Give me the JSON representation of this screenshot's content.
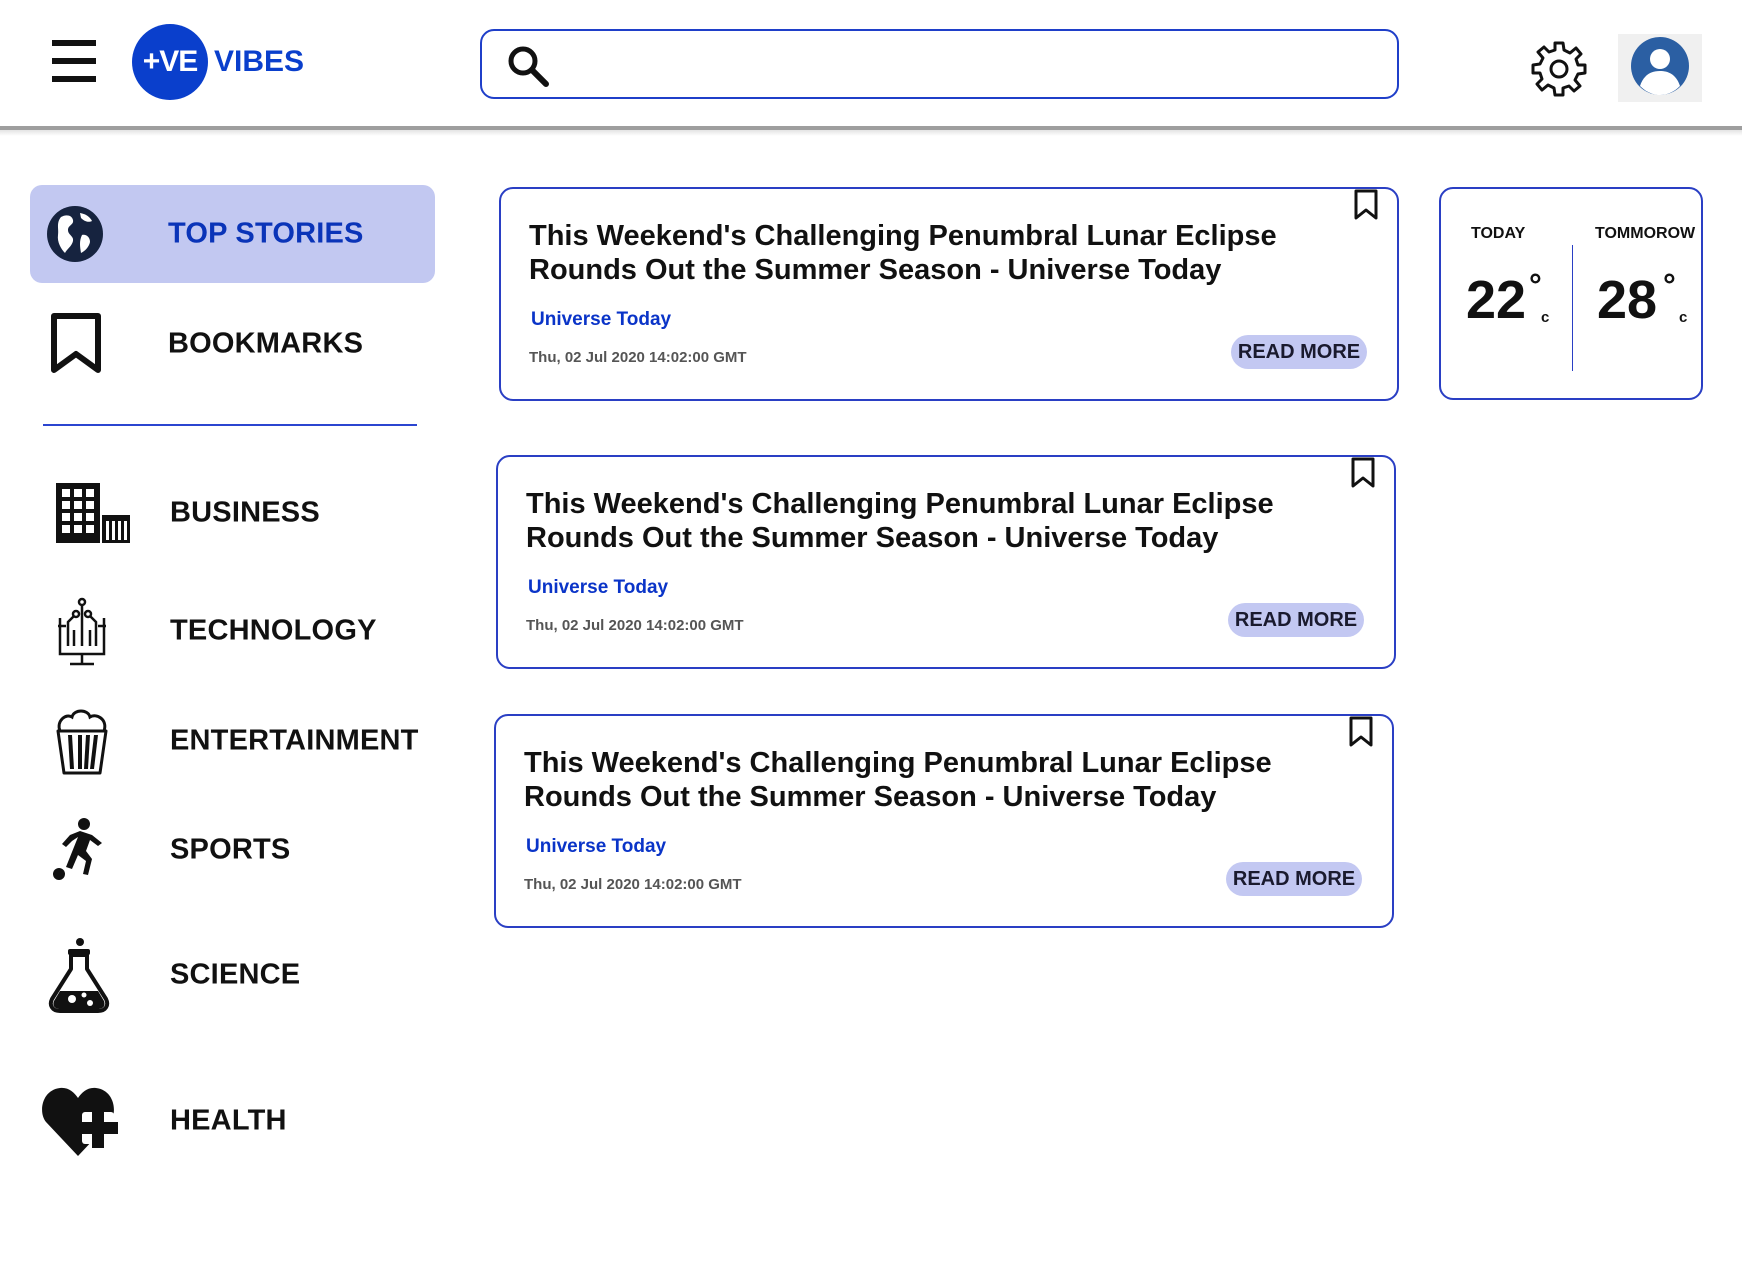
{
  "header": {
    "logo_mark": "+VE",
    "logo_word": "VIBES",
    "search_placeholder": ""
  },
  "sidebar": {
    "items": [
      {
        "label": "TOP STORIES",
        "icon": "globe-icon",
        "active": true
      },
      {
        "label": "BOOKMARKS",
        "icon": "bookmark-icon",
        "active": false
      },
      {
        "label": "BUSINESS",
        "icon": "building-icon",
        "active": false
      },
      {
        "label": "TECHNOLOGY",
        "icon": "circuit-icon",
        "active": false
      },
      {
        "label": "ENTERTAINMENT",
        "icon": "popcorn-icon",
        "active": false
      },
      {
        "label": "SPORTS",
        "icon": "soccer-player-icon",
        "active": false
      },
      {
        "label": "SCIENCE",
        "icon": "flask-icon",
        "active": false
      },
      {
        "label": "HEALTH",
        "icon": "heart-plus-icon",
        "active": false
      }
    ]
  },
  "articles": [
    {
      "title": "This Weekend's Challenging Penumbral Lunar Eclipse Rounds Out the Summer Season - Universe Today",
      "source": "Universe Today",
      "date": "Thu, 02 Jul 2020 14:02:00 GMT",
      "read_more": "READ MORE"
    },
    {
      "title": "This Weekend's Challenging Penumbral Lunar Eclipse Rounds Out the Summer Season - Universe Today",
      "source": "Universe Today",
      "date": "Thu, 02 Jul 2020 14:02:00 GMT",
      "read_more": "READ MORE"
    },
    {
      "title": "This Weekend's Challenging Penumbral Lunar Eclipse Rounds Out the Summer Season - Universe Today",
      "source": "Universe Today",
      "date": "Thu, 02 Jul 2020 14:02:00 GMT",
      "read_more": "READ MORE"
    }
  ],
  "weather": {
    "today": {
      "label": "TODAY",
      "temp": "22",
      "degree": "°",
      "unit": "c"
    },
    "tomorrow": {
      "label": "TOMMOROW",
      "temp": "28",
      "degree": "°",
      "unit": "c"
    }
  },
  "colors": {
    "brand": "#0a3fcc",
    "accent_border": "#2a3fc4",
    "active_nav_bg": "#c2c8f1",
    "button_bg": "#c3c8f2"
  }
}
